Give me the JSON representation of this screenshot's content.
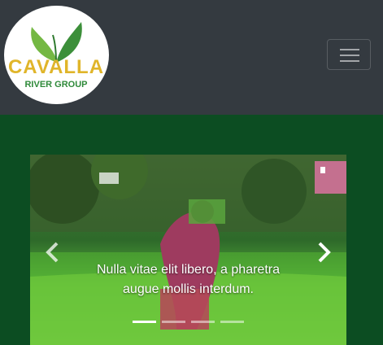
{
  "brand": {
    "logo_line1": "CAVALLA",
    "logo_line2": "RIVER GROUP",
    "colors": {
      "primary": "#e0b52a",
      "accent": "#2f8a3a"
    }
  },
  "navbar": {
    "toggler_icon": "hamburger-icon",
    "background": "#343a40"
  },
  "page": {
    "background": "#0c4d22"
  },
  "carousel": {
    "slide_description": "Farmer planting rice seedlings in a green paddy field",
    "caption": "Nulla vitae elit libero, a pharetra augue mollis interdum.",
    "prev_icon": "chevron-left-icon",
    "next_icon": "chevron-right-icon",
    "indicator_count": 4,
    "active_indicator": 0
  }
}
